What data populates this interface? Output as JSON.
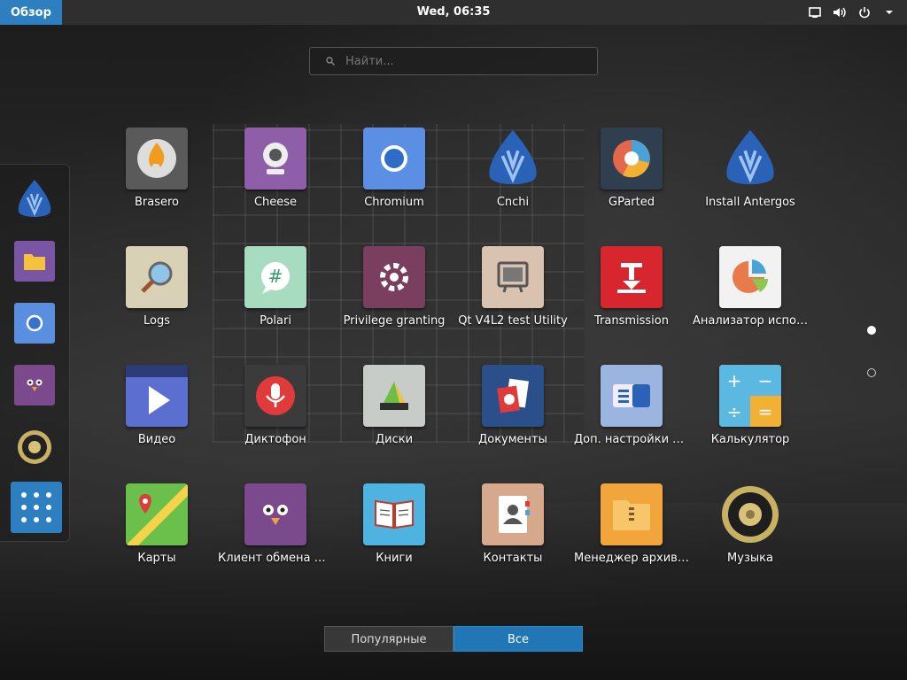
{
  "topbar": {
    "overview_label": "Обзор",
    "clock": "Wed, 06:35"
  },
  "search": {
    "placeholder": "Найти..."
  },
  "dash": {
    "items": [
      "antergos-icon",
      "files-icon",
      "chromium-icon",
      "pidgin-icon",
      "speaker-icon"
    ],
    "show_apps_icon": "apps-grid-icon"
  },
  "apps": [
    {
      "label": "Brasero",
      "icon": "brasero-icon"
    },
    {
      "label": "Cheese",
      "icon": "cheese-icon"
    },
    {
      "label": "Chromium",
      "icon": "chromium-icon"
    },
    {
      "label": "Cnchi",
      "icon": "cnchi-icon"
    },
    {
      "label": "GParted",
      "icon": "gparted-icon"
    },
    {
      "label": "Install Antergos",
      "icon": "antergos-icon"
    },
    {
      "label": "Logs",
      "icon": "logs-icon"
    },
    {
      "label": "Polari",
      "icon": "polari-icon"
    },
    {
      "label": "Privilege granting",
      "icon": "privilege-icon"
    },
    {
      "label": "Qt V4L2 test Utility",
      "icon": "qt-v4l2-icon"
    },
    {
      "label": "Transmission",
      "icon": "transmission-icon"
    },
    {
      "label": "Анализатор использования дисков",
      "icon": "disk-usage-icon"
    },
    {
      "label": "Видео",
      "icon": "video-icon"
    },
    {
      "label": "Диктофон",
      "icon": "recorder-icon"
    },
    {
      "label": "Диски",
      "icon": "disks-icon"
    },
    {
      "label": "Документы",
      "icon": "documents-icon"
    },
    {
      "label": "Доп. настройки GNOME",
      "icon": "tweaks-icon"
    },
    {
      "label": "Калькулятор",
      "icon": "calculator-icon"
    },
    {
      "label": "Карты",
      "icon": "maps-icon"
    },
    {
      "label": "Клиент обмена мгновенными сообщениями Pidgin",
      "icon": "pidgin-icon"
    },
    {
      "label": "Книги",
      "icon": "books-icon"
    },
    {
      "label": "Контакты",
      "icon": "contacts-icon"
    },
    {
      "label": "Менеджер архивов",
      "icon": "archive-icon"
    },
    {
      "label": "Музыка",
      "icon": "music-icon"
    }
  ],
  "tabs": {
    "popular_label": "Популярные",
    "all_label": "Все"
  },
  "colors": {
    "accent": "#2d7fbf",
    "topbar": "#2f2f2f"
  }
}
